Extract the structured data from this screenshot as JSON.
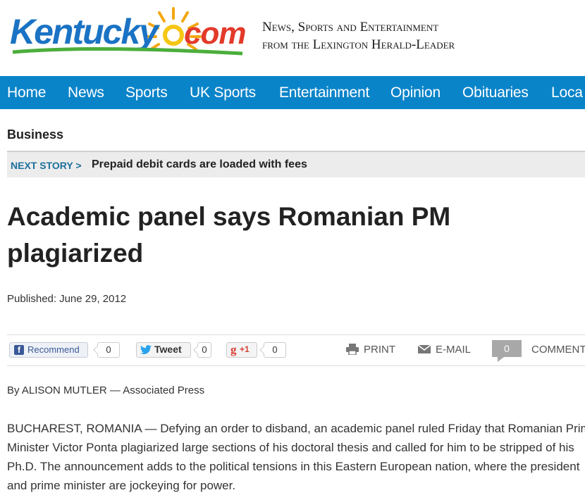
{
  "site": {
    "logo_text": "Kentucky.com",
    "tagline_line1": "News, Sports and Entertainment",
    "tagline_line2": "from the Lexington Herald-Leader"
  },
  "nav": {
    "items": [
      "Home",
      "News",
      "Sports",
      "UK Sports",
      "Entertainment",
      "Opinion",
      "Obituaries",
      "Loca"
    ]
  },
  "section": {
    "label": "Business"
  },
  "next_story": {
    "tag": "NEXT STORY >",
    "title": "Prepaid debit cards are loaded with fees"
  },
  "article": {
    "headline": "Academic panel says Romanian PM plagiarized",
    "published_label": "Published:",
    "published_date": "June 29, 2012",
    "byline": "By ALISON MUTLER — Associated Press",
    "body": "BUCHAREST, ROMANIA — Defying an order to disband, an academic panel ruled Friday that Romanian Prime Minister Victor Ponta plagiarized large sections of his doctoral thesis and called for him to be stripped of his Ph.D. The announcement adds to the political tensions in this Eastern European nation, where the president and prime minister are jockeying for power."
  },
  "social": {
    "facebook_label": "Recommend",
    "facebook_count": "0",
    "twitter_label": "Tweet",
    "twitter_count": "0",
    "gplus_label": "+1",
    "gplus_count": "0",
    "print_label": "PRINT",
    "email_label": "E-MAIL",
    "comment_count": "0",
    "comments_label": "COMMENTS"
  },
  "colors": {
    "nav_bg": "#0a84c9",
    "logo_blue": "#1a73c4",
    "next_story_tag": "#1c6f9b"
  },
  "icons": [
    "facebook-icon",
    "twitter-icon",
    "gplus-icon",
    "printer-icon",
    "envelope-icon",
    "sun-icon"
  ]
}
